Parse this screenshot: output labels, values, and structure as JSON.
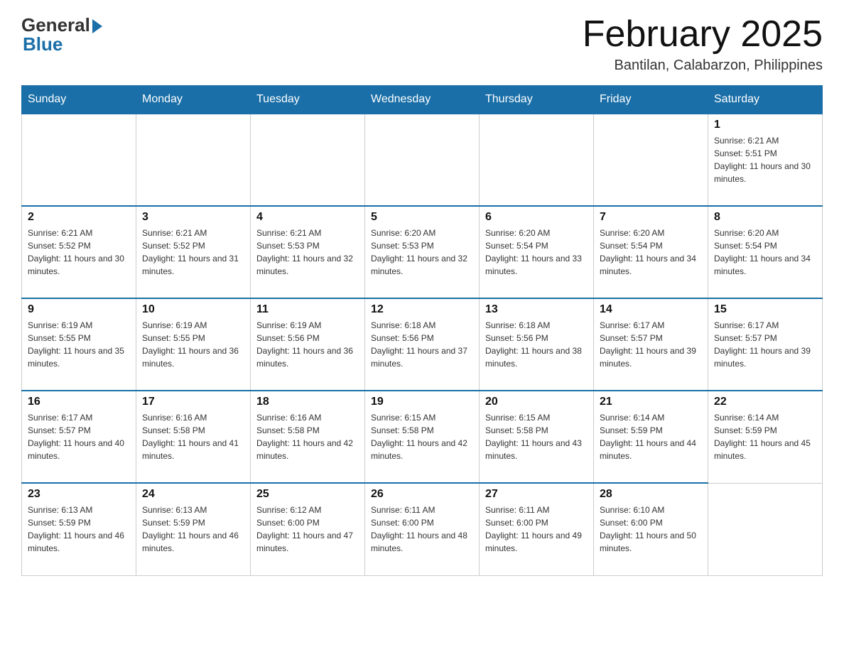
{
  "logo": {
    "general": "General",
    "blue": "Blue"
  },
  "title": "February 2025",
  "subtitle": "Bantilan, Calabarzon, Philippines",
  "weekdays": [
    "Sunday",
    "Monday",
    "Tuesday",
    "Wednesday",
    "Thursday",
    "Friday",
    "Saturday"
  ],
  "weeks": [
    [
      {
        "day": "",
        "info": ""
      },
      {
        "day": "",
        "info": ""
      },
      {
        "day": "",
        "info": ""
      },
      {
        "day": "",
        "info": ""
      },
      {
        "day": "",
        "info": ""
      },
      {
        "day": "",
        "info": ""
      },
      {
        "day": "1",
        "info": "Sunrise: 6:21 AM\nSunset: 5:51 PM\nDaylight: 11 hours and 30 minutes."
      }
    ],
    [
      {
        "day": "2",
        "info": "Sunrise: 6:21 AM\nSunset: 5:52 PM\nDaylight: 11 hours and 30 minutes."
      },
      {
        "day": "3",
        "info": "Sunrise: 6:21 AM\nSunset: 5:52 PM\nDaylight: 11 hours and 31 minutes."
      },
      {
        "day": "4",
        "info": "Sunrise: 6:21 AM\nSunset: 5:53 PM\nDaylight: 11 hours and 32 minutes."
      },
      {
        "day": "5",
        "info": "Sunrise: 6:20 AM\nSunset: 5:53 PM\nDaylight: 11 hours and 32 minutes."
      },
      {
        "day": "6",
        "info": "Sunrise: 6:20 AM\nSunset: 5:54 PM\nDaylight: 11 hours and 33 minutes."
      },
      {
        "day": "7",
        "info": "Sunrise: 6:20 AM\nSunset: 5:54 PM\nDaylight: 11 hours and 34 minutes."
      },
      {
        "day": "8",
        "info": "Sunrise: 6:20 AM\nSunset: 5:54 PM\nDaylight: 11 hours and 34 minutes."
      }
    ],
    [
      {
        "day": "9",
        "info": "Sunrise: 6:19 AM\nSunset: 5:55 PM\nDaylight: 11 hours and 35 minutes."
      },
      {
        "day": "10",
        "info": "Sunrise: 6:19 AM\nSunset: 5:55 PM\nDaylight: 11 hours and 36 minutes."
      },
      {
        "day": "11",
        "info": "Sunrise: 6:19 AM\nSunset: 5:56 PM\nDaylight: 11 hours and 36 minutes."
      },
      {
        "day": "12",
        "info": "Sunrise: 6:18 AM\nSunset: 5:56 PM\nDaylight: 11 hours and 37 minutes."
      },
      {
        "day": "13",
        "info": "Sunrise: 6:18 AM\nSunset: 5:56 PM\nDaylight: 11 hours and 38 minutes."
      },
      {
        "day": "14",
        "info": "Sunrise: 6:17 AM\nSunset: 5:57 PM\nDaylight: 11 hours and 39 minutes."
      },
      {
        "day": "15",
        "info": "Sunrise: 6:17 AM\nSunset: 5:57 PM\nDaylight: 11 hours and 39 minutes."
      }
    ],
    [
      {
        "day": "16",
        "info": "Sunrise: 6:17 AM\nSunset: 5:57 PM\nDaylight: 11 hours and 40 minutes."
      },
      {
        "day": "17",
        "info": "Sunrise: 6:16 AM\nSunset: 5:58 PM\nDaylight: 11 hours and 41 minutes."
      },
      {
        "day": "18",
        "info": "Sunrise: 6:16 AM\nSunset: 5:58 PM\nDaylight: 11 hours and 42 minutes."
      },
      {
        "day": "19",
        "info": "Sunrise: 6:15 AM\nSunset: 5:58 PM\nDaylight: 11 hours and 42 minutes."
      },
      {
        "day": "20",
        "info": "Sunrise: 6:15 AM\nSunset: 5:58 PM\nDaylight: 11 hours and 43 minutes."
      },
      {
        "day": "21",
        "info": "Sunrise: 6:14 AM\nSunset: 5:59 PM\nDaylight: 11 hours and 44 minutes."
      },
      {
        "day": "22",
        "info": "Sunrise: 6:14 AM\nSunset: 5:59 PM\nDaylight: 11 hours and 45 minutes."
      }
    ],
    [
      {
        "day": "23",
        "info": "Sunrise: 6:13 AM\nSunset: 5:59 PM\nDaylight: 11 hours and 46 minutes."
      },
      {
        "day": "24",
        "info": "Sunrise: 6:13 AM\nSunset: 5:59 PM\nDaylight: 11 hours and 46 minutes."
      },
      {
        "day": "25",
        "info": "Sunrise: 6:12 AM\nSunset: 6:00 PM\nDaylight: 11 hours and 47 minutes."
      },
      {
        "day": "26",
        "info": "Sunrise: 6:11 AM\nSunset: 6:00 PM\nDaylight: 11 hours and 48 minutes."
      },
      {
        "day": "27",
        "info": "Sunrise: 6:11 AM\nSunset: 6:00 PM\nDaylight: 11 hours and 49 minutes."
      },
      {
        "day": "28",
        "info": "Sunrise: 6:10 AM\nSunset: 6:00 PM\nDaylight: 11 hours and 50 minutes."
      },
      {
        "day": "",
        "info": ""
      }
    ]
  ]
}
